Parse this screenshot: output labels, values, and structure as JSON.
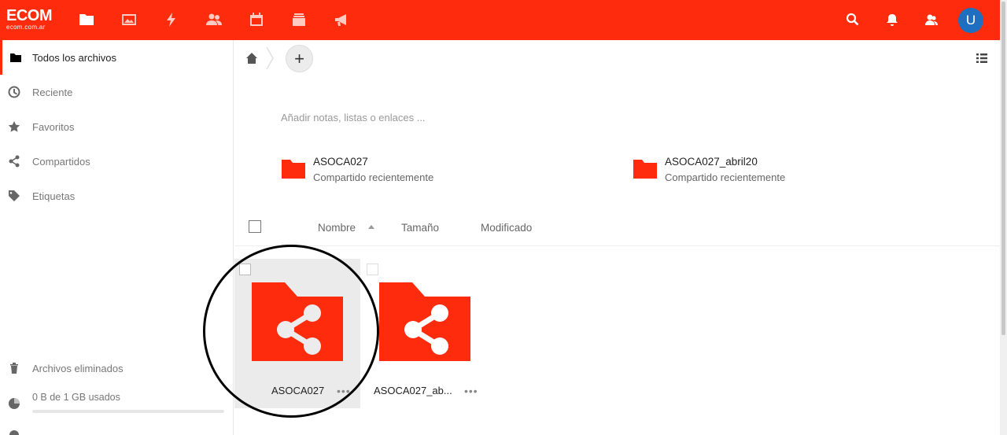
{
  "header": {
    "logo_big": "ECOM",
    "logo_small": "ecom.com.ar",
    "apps": [
      "files-icon",
      "photos-icon",
      "activity-icon",
      "contacts-icon",
      "calendar-icon",
      "deck-icon",
      "announcements-icon"
    ],
    "right": [
      "search-icon",
      "bell-icon",
      "contacts-menu-icon"
    ],
    "avatar_letter": "U",
    "accent": "#ff2b0d"
  },
  "sidebar": {
    "items": [
      {
        "label": "Todos los archivos",
        "icon": "folder-icon",
        "active": true
      },
      {
        "label": "Reciente",
        "icon": "clock-icon"
      },
      {
        "label": "Favoritos",
        "icon": "star-icon"
      },
      {
        "label": "Compartidos",
        "icon": "share-icon"
      },
      {
        "label": "Etiquetas",
        "icon": "tag-icon"
      }
    ],
    "deleted_label": "Archivos eliminados",
    "quota_label": "0 B de 1 GB usados",
    "quota_fraction": 0.0
  },
  "main": {
    "notes_placeholder": "Añadir notas, listas o enlaces ...",
    "recent": [
      {
        "name": "ASOCA027",
        "sub": "Compartido recientemente"
      },
      {
        "name": "ASOCA027_abril20",
        "sub": "Compartido recientemente"
      }
    ],
    "columns": {
      "name": "Nombre",
      "size": "Tamaño",
      "modified": "Modificado"
    },
    "files": [
      {
        "name": "ASOCA027",
        "more": "•••"
      },
      {
        "name": "ASOCA027_ab...",
        "more": "•••"
      }
    ]
  }
}
